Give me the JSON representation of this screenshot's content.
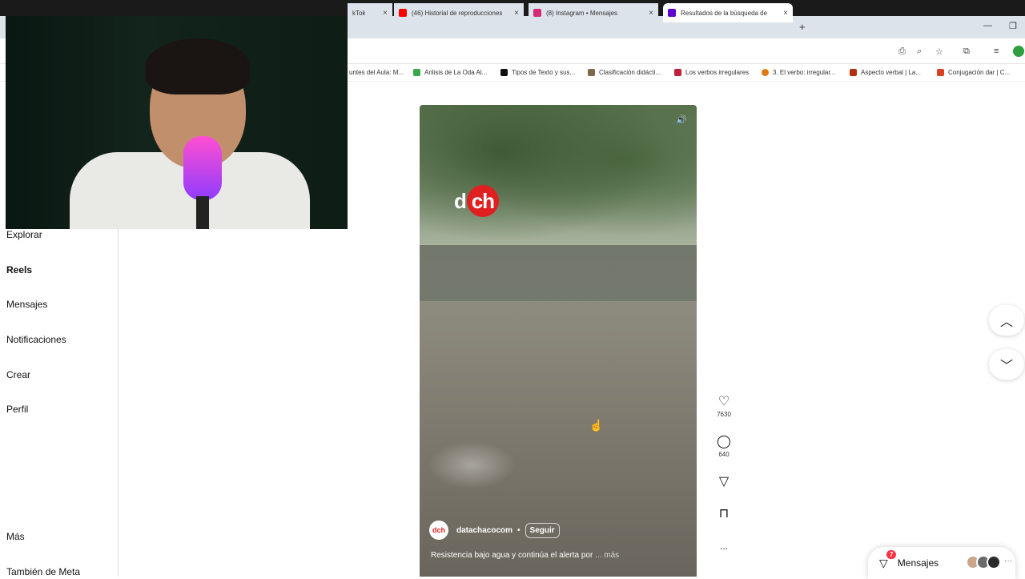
{
  "browser": {
    "tabs": [
      {
        "title": "kTok",
        "icon": "tiktok-icon",
        "color": "#000000"
      },
      {
        "title": "(46) Historial de reproducciones",
        "icon": "youtube-icon",
        "color": "#ff0000"
      },
      {
        "title": "(8) Instagram • Mensajes",
        "icon": "instagram-icon",
        "color": "#d62976"
      },
      {
        "title": "Resultados de la búsqueda de",
        "icon": "yahoo-icon",
        "color": "#6001d2"
      }
    ],
    "new_tab": "+",
    "bookmarks": [
      {
        "label": "untes del Aula: M...",
        "color": "#888888"
      },
      {
        "label": "Anlisis de La Oda Al...",
        "color": "#3aa84a"
      },
      {
        "label": "Tipos de Texto y sus...",
        "color": "#111111"
      },
      {
        "label": "Clasificación didácti...",
        "color": "#7a6a4a"
      },
      {
        "label": "Los verbos irregulares",
        "color": "#c0203a"
      },
      {
        "label": "3. El verbo: irregular...",
        "color": "#e07a10"
      },
      {
        "label": "Aspecto verbal | La...",
        "color": "#b03010"
      },
      {
        "label": "Conjugación dar | C...",
        "color": "#d84020"
      }
    ]
  },
  "sidebar": {
    "items": [
      {
        "label": "Explorar"
      },
      {
        "label": "Reels"
      },
      {
        "label": "Mensajes"
      },
      {
        "label": "Notificaciones"
      },
      {
        "label": "Crear"
      },
      {
        "label": "Perfil"
      },
      {
        "label": "Más"
      },
      {
        "label": "También de Meta"
      }
    ]
  },
  "reel": {
    "watermark_d": "d",
    "watermark_ch": "ch",
    "author": "datachacocom",
    "author_avatar": "dch",
    "separator": "•",
    "follow": "Seguir",
    "caption": "Resistencia bajo agua y continúa el alerta por",
    "caption_ellipsis": "... ",
    "more": "más",
    "mute_icon": "speaker-icon"
  },
  "actions": {
    "likes": "7630",
    "comments": "640",
    "more": "..."
  },
  "messages_pill": {
    "label": "Mensajes",
    "badge": "7"
  }
}
